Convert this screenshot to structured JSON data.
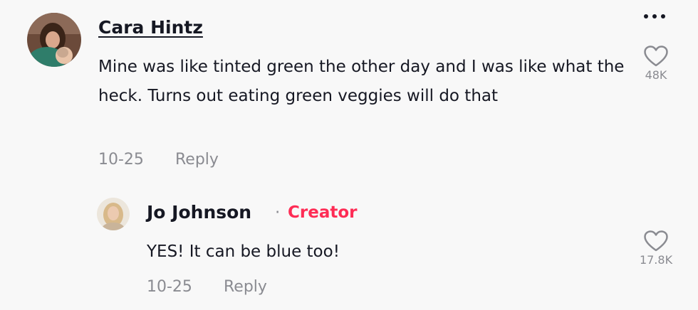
{
  "comment": {
    "author": "Cara Hintz",
    "text": "Mine was like tinted green the other day and I was like what the heck. Turns out eating green veggies will do that",
    "date": "10-25",
    "reply_label": "Reply",
    "likes": "48K",
    "more_icon": "more-horizontal-icon",
    "like_icon": "heart-outline-icon"
  },
  "reply": {
    "author": "Jo Johnson",
    "separator": "·",
    "badge": "Creator",
    "text": "YES! It can be blue too!",
    "date": "10-25",
    "reply_label": "Reply",
    "likes": "17.8K",
    "like_icon": "heart-outline-icon"
  },
  "colors": {
    "text": "#161823",
    "muted": "#8a8b91",
    "creator_badge": "#fe2c55",
    "background": "#f8f8f8"
  }
}
